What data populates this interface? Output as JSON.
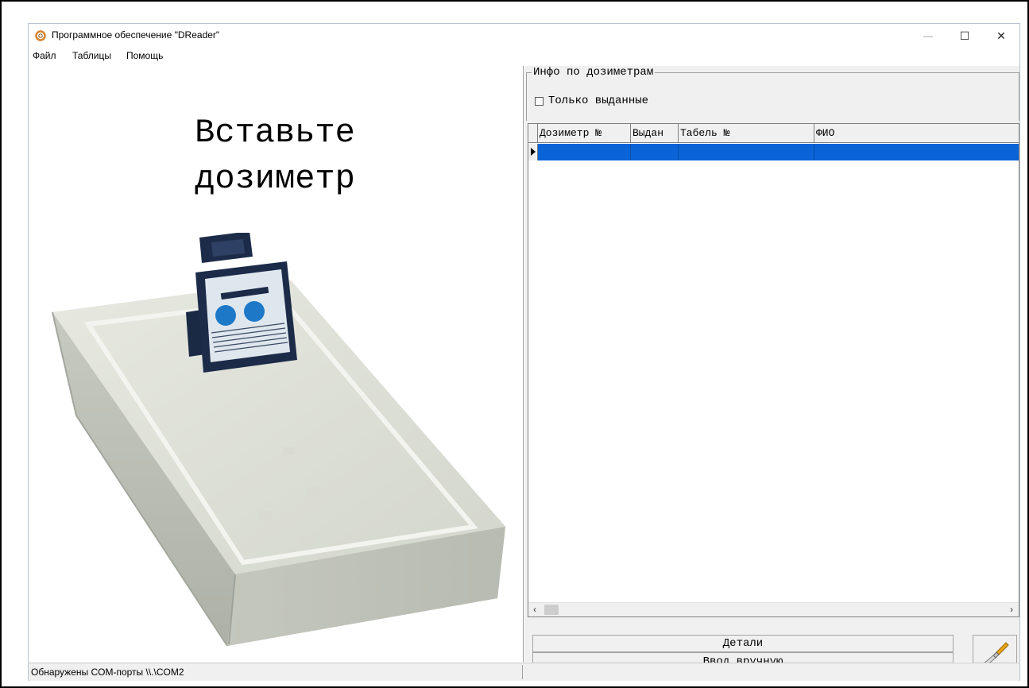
{
  "window": {
    "title": "Программное обеспечение \"DReader\"",
    "minimize_icon": "minimize-icon",
    "maximize_icon": "maximize-icon",
    "close_icon": "close-icon",
    "minimize_glyph": "—",
    "maximize_glyph": "☐",
    "close_glyph": "✕"
  },
  "menu": {
    "items": [
      "Файл",
      "Таблицы",
      "Помощь"
    ]
  },
  "left_pane": {
    "prompt_line1": "Вставьте",
    "prompt_line2": "дозиметр",
    "image": "dosimeter-reader-photo"
  },
  "dosimeter_info": {
    "group_title": "Инфо по дозиметрам",
    "only_issued_label": "Только выданные",
    "only_issued_checked": false,
    "columns": [
      "Дозиметр №",
      "Выдан",
      "Табель №",
      "ФИО"
    ],
    "rows": [
      [
        "",
        "",
        "",
        ""
      ]
    ],
    "selected_row": 0
  },
  "scrollbar": {
    "left_arrow": "‹",
    "right_arrow": "›"
  },
  "buttons": {
    "details_label": "Детали",
    "manual_entry_label": "Ввод вручную",
    "settings_icon": "screwdriver-icon"
  },
  "status": {
    "text": "Обнаружены COM-порты \\\\.\\COM2"
  },
  "colors": {
    "selection": "#0a64d7",
    "pane_background": "#f0f0f0",
    "app_icon_accent": "#d9822b"
  }
}
